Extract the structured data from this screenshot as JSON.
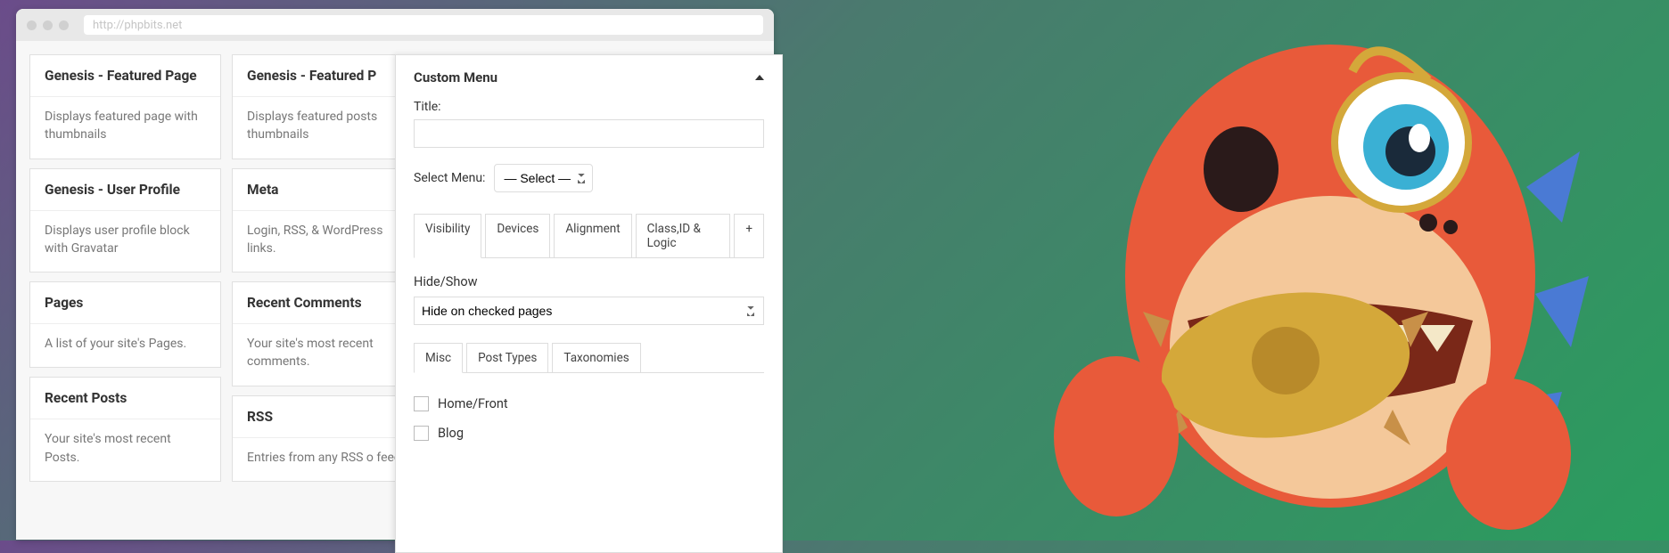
{
  "url_placeholder": "http://phpbits.net",
  "widgets": [
    [
      {
        "title": "Genesis - Featured Page",
        "desc": "Displays featured page with thumbnails"
      },
      {
        "title": "Genesis - User Profile",
        "desc": "Displays user profile block with Gravatar"
      },
      {
        "title": "Pages",
        "desc": "A list of your site's Pages."
      },
      {
        "title": "Recent Posts",
        "desc": "Your site's most recent Posts."
      }
    ],
    [
      {
        "title": "Genesis - Featured P",
        "desc": "Displays featured posts thumbnails"
      },
      {
        "title": "Meta",
        "desc": "Login, RSS, & WordPress links."
      },
      {
        "title": "Recent Comments",
        "desc": "Your site's most recent comments."
      },
      {
        "title": "RSS",
        "desc": "Entries from any RSS o feed."
      }
    ]
  ],
  "panel": {
    "title": "Custom Menu",
    "field_title": "Title:",
    "field_menu": "Select Menu:",
    "menu_placeholder": "— Select —",
    "tabs": [
      "Visibility",
      "Devices",
      "Alignment",
      "Class,ID & Logic",
      "+"
    ],
    "hideshow_label": "Hide/Show",
    "hideshow_value": "Hide on checked pages",
    "subtabs": [
      "Misc",
      "Post Types",
      "Taxonomies"
    ],
    "checks": [
      "Home/Front",
      "Blog"
    ]
  }
}
